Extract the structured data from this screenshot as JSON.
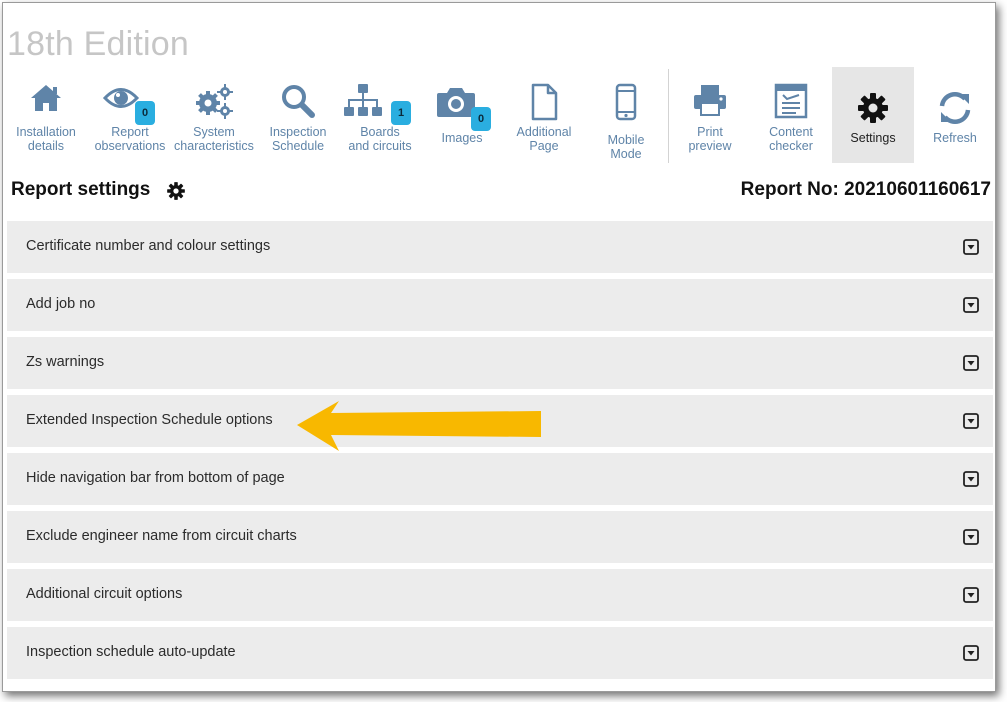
{
  "app": {
    "title": "18th Edition"
  },
  "toolbar": {
    "items": [
      {
        "label": "Installation\ndetails",
        "icon": "home-icon"
      },
      {
        "label": "Report\nobservations",
        "icon": "eye-icon",
        "badge": "0"
      },
      {
        "label": "System\ncharacteristics",
        "icon": "gears-icon"
      },
      {
        "label": "Inspection\nSchedule",
        "icon": "search-icon"
      },
      {
        "label": "Boards\nand circuits",
        "icon": "sitemap-icon",
        "badge": "1"
      },
      {
        "label": "Images",
        "icon": "camera-icon",
        "badge": "0"
      },
      {
        "label": "Additional\nPage",
        "icon": "file-icon"
      },
      {
        "label": "Mobile\nMode",
        "icon": "mobile-icon"
      },
      {
        "label": "Print\npreview",
        "icon": "printer-icon"
      },
      {
        "label": "Content\nchecker",
        "icon": "checklist-icon"
      },
      {
        "label": "Settings",
        "icon": "gear-icon",
        "active": true
      },
      {
        "label": "Refresh",
        "icon": "refresh-icon"
      }
    ]
  },
  "settings": {
    "heading": "Report settings",
    "report_no": "Report No: 20210601160617",
    "sections": [
      "Certificate number and colour settings",
      "Add job no",
      "Zs warnings",
      "Extended Inspection Schedule options",
      "Hide navigation bar from bottom of page",
      "Exclude engineer name from circuit charts",
      "Additional circuit options",
      "Inspection schedule auto-update"
    ]
  },
  "colors": {
    "icon": "#5f84a8",
    "badge": "#2aaee0",
    "panel_bg": "#ececec",
    "arrow": "#f8b800",
    "title": "#c6c6c6"
  }
}
